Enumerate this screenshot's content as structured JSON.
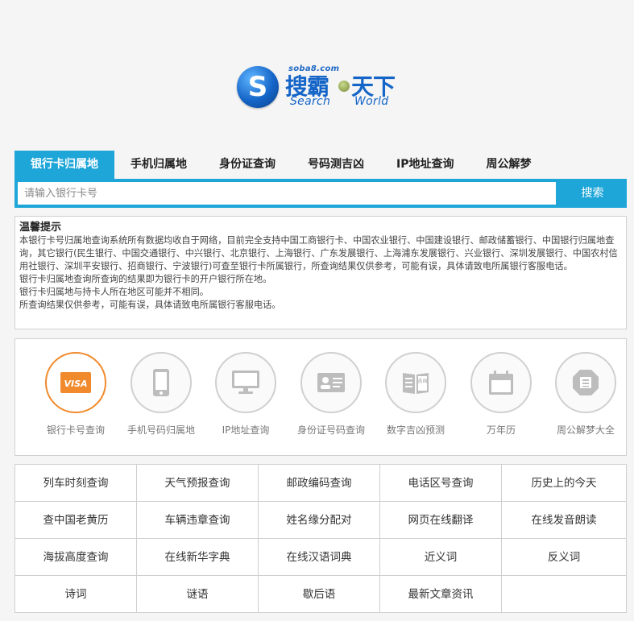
{
  "logo": {
    "domain": "soba8.com",
    "name_cn_1": "搜霸",
    "name_cn_2": "天下",
    "name_en_1": "Search",
    "name_en_2": "World",
    "mark": "S"
  },
  "tabs": [
    {
      "label": "银行卡归属地",
      "active": true
    },
    {
      "label": "手机归属地"
    },
    {
      "label": "身份证查询"
    },
    {
      "label": "号码测吉凶"
    },
    {
      "label": "IP地址查询"
    },
    {
      "label": "周公解梦"
    }
  ],
  "search": {
    "placeholder": "请输入银行卡号",
    "button_label": "搜索"
  },
  "tips": {
    "title": "温馨提示",
    "lines": [
      "本银行卡号归属地查询系统所有数据均收自于网络，目前完全支持中国工商银行卡、中国农业银行、中国建设银行、邮政储蓄银行、中国银行归属地查询，其它银行(民生银行、中国交通银行、中兴银行、北京银行、上海银行、广东发展银行、上海浦东发展银行、兴业银行、深圳发展银行、中国农村信用社银行、深圳平安银行、招商银行、宁波银行)可查至银行卡所属银行，所查询结果仅供参考，可能有误，具体请致电所属银行客服电话。",
      "银行卡归属地查询所查询的结果即为银行卡的开户银行所在地。",
      "银行卡归属地与持卡人所在地区可能并不相同。",
      "所查询结果仅供参考，可能有误，具体请致电所属银行客服电话。"
    ]
  },
  "icons": [
    {
      "label": "银行卡号查询",
      "icon": "visa-card-icon",
      "active": true,
      "badge": "VISA"
    },
    {
      "label": "手机号码归属地",
      "icon": "mobile-phone-icon"
    },
    {
      "label": "IP地址查询",
      "icon": "monitor-icon"
    },
    {
      "label": "身份证号码查询",
      "icon": "id-card-icon"
    },
    {
      "label": "数字吉凶预测",
      "icon": "book-icon",
      "badge": "吉凶"
    },
    {
      "label": "万年历",
      "icon": "calendar-icon"
    },
    {
      "label": "周公解梦大全",
      "icon": "dream-icon"
    }
  ],
  "links": [
    [
      "列车时刻查询",
      "天气预报查询",
      "邮政编码查询",
      "电话区号查询",
      "历史上的今天"
    ],
    [
      "查中国老黄历",
      "车辆违章查询",
      "姓名缘分配对",
      "网页在线翻译",
      "在线发音朗读"
    ],
    [
      "海拔高度查询",
      "在线新华字典",
      "在线汉语词典",
      "近义词",
      "反义词"
    ],
    [
      "诗词",
      "谜语",
      "歇后语",
      "最新文章资讯",
      ""
    ]
  ],
  "colors": {
    "accent": "#1ea6d9",
    "active_icon": "#f08a2c",
    "logo_blue": "#1565c8"
  }
}
